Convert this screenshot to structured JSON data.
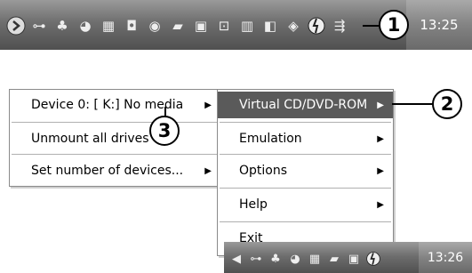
{
  "taskbar": {
    "clock": "13:25",
    "icons": [
      "start-arrow-icon",
      "plug-icon",
      "camel-icon",
      "globe-icon",
      "printer-icon",
      "shield-icon",
      "disc-icon",
      "folder-icon",
      "floppy-icon",
      "lock-icon",
      "mixer-icon",
      "speaker-icon",
      "diamond-icon",
      "daemon-tools-icon",
      "usb-icon"
    ]
  },
  "callouts": {
    "one": "1",
    "two": "2",
    "three": "3"
  },
  "menu_left": {
    "items": [
      {
        "label": "Device 0: [ K:] No media",
        "has_submenu": true
      },
      {
        "label": "Unmount all drives",
        "has_submenu": false
      },
      {
        "label": "Set number of devices...",
        "has_submenu": true
      }
    ]
  },
  "menu_right": {
    "items": [
      {
        "label": "Virtual CD/DVD-ROM",
        "has_submenu": true,
        "highlighted": true
      },
      {
        "label": "Emulation",
        "has_submenu": true
      },
      {
        "label": "Options",
        "has_submenu": true
      },
      {
        "label": "Help",
        "has_submenu": true
      },
      {
        "label": "Exit",
        "has_submenu": false
      }
    ]
  },
  "taskbar_lower": {
    "clock": "13:26"
  },
  "colors": {
    "taskbar": "#6e6e6e",
    "highlight": "#5a5a5a",
    "menu_bg": "#ffffff"
  }
}
